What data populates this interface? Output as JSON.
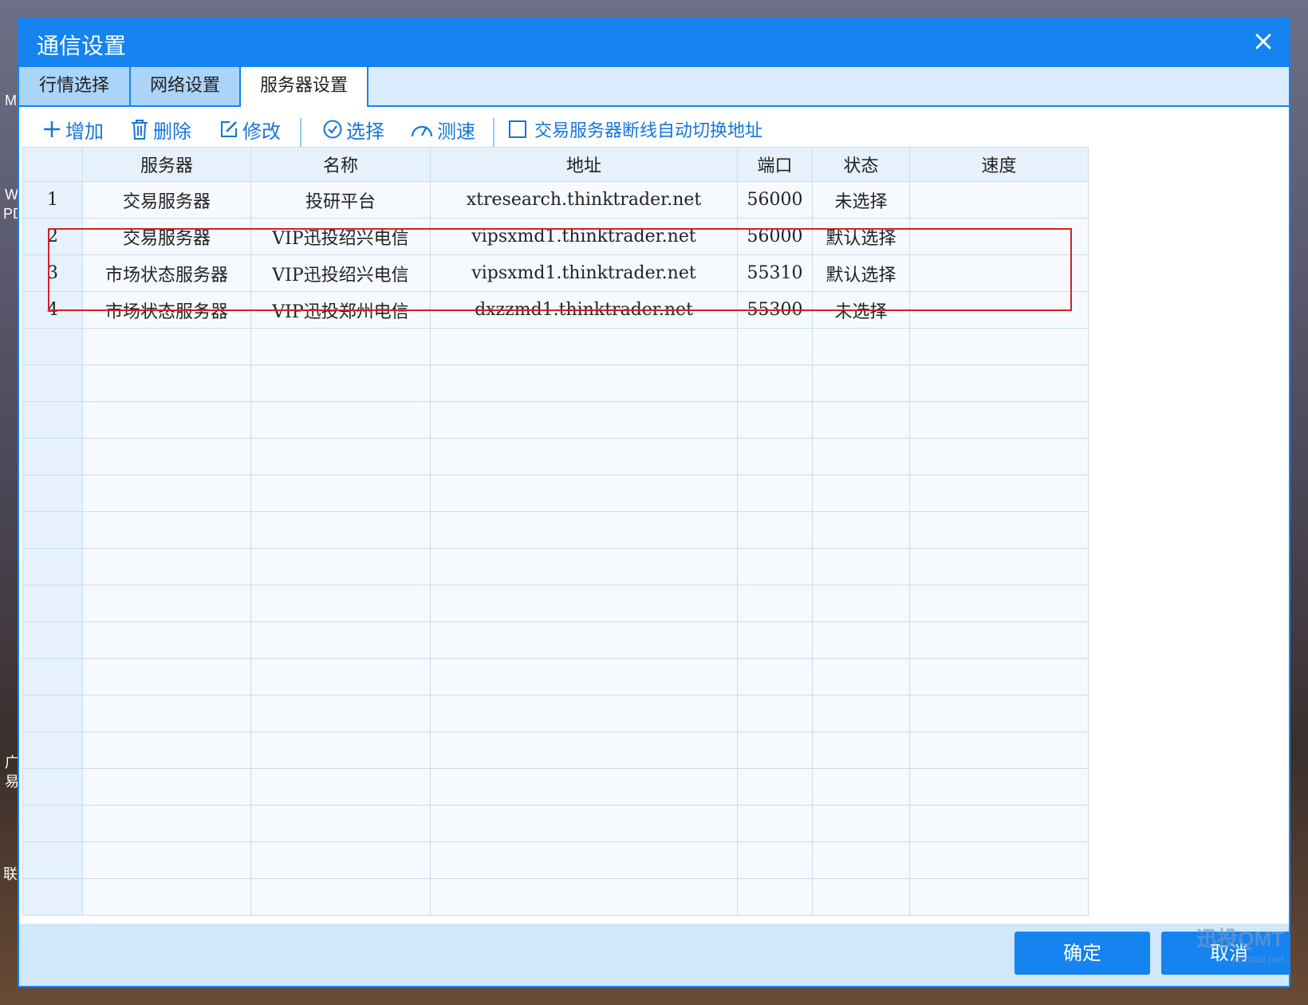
{
  "desktop": {
    "fragments": [
      "M",
      "W",
      "PD",
      "广",
      "易",
      "联"
    ]
  },
  "dialog": {
    "title": "通信设置",
    "close_icon": "close-icon"
  },
  "tabs": [
    "行情选择",
    "网络设置",
    "服务器设置"
  ],
  "active_tab": "服务器设置",
  "toolbar": {
    "add": "增加",
    "delete": "删除",
    "edit": "修改",
    "select": "选择",
    "speed_test": "测速",
    "auto_switch_label": "交易服务器断线自动切换地址",
    "auto_switch_checked": false
  },
  "table": {
    "headers": [
      "",
      "服务器",
      "名称",
      "地址",
      "端口",
      "状态",
      "速度"
    ],
    "rows": [
      {
        "no": "1",
        "server": "交易服务器",
        "name": "投研平台",
        "address": "xtresearch.thinktrader.net",
        "port": "56000",
        "status": "未选择",
        "speed": ""
      },
      {
        "no": "2",
        "server": "交易服务器",
        "name": "VIP迅投绍兴电信",
        "address": "vipsxmd1.thinktrader.net",
        "port": "56000",
        "status": "默认选择",
        "speed": ""
      },
      {
        "no": "3",
        "server": "市场状态服务器",
        "name": "VIP迅投绍兴电信",
        "address": "vipsxmd1.thinktrader.net",
        "port": "55310",
        "status": "默认选择",
        "speed": ""
      },
      {
        "no": "4",
        "server": "市场状态服务器",
        "name": "VIP迅投郑州电信",
        "address": "dxzzmd1.thinktrader.net",
        "port": "55300",
        "status": "未选择",
        "speed": ""
      }
    ],
    "empty_rows": 16
  },
  "footer": {
    "ok": "确定",
    "cancel": "取消"
  },
  "watermark": {
    "main": "迅投QMT",
    "sub": "xuntou.net"
  },
  "colors": {
    "accent": "#1583f0",
    "unselected": "#ee7a2a",
    "default_selected": "#2ea24a",
    "highlight": "#d61f2a"
  }
}
